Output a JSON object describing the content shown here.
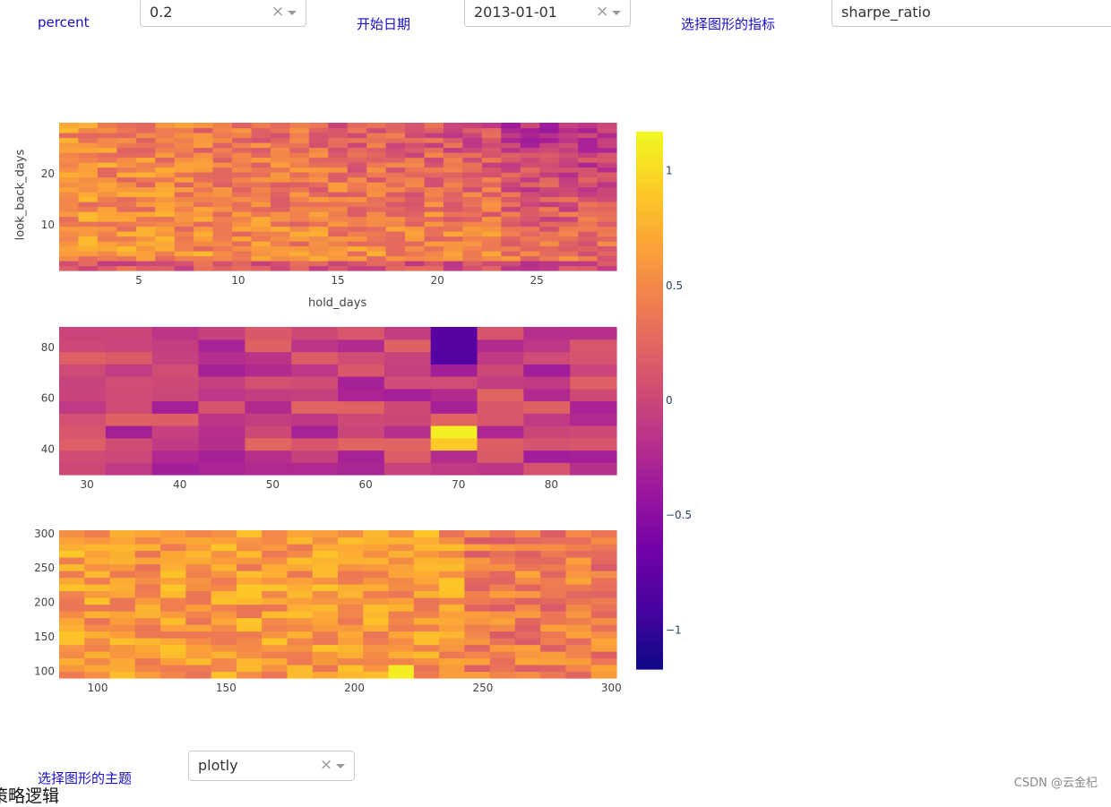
{
  "controls": {
    "percent_label": "percent",
    "percent_value": "0.2",
    "start_date_label": "开始日期",
    "start_date_value": "2013-01-01",
    "metric_label": "选择图形的指标",
    "metric_value": "sharpe_ratio",
    "theme_label": "选择图形的主题",
    "theme_value": "plotly",
    "clear_icon": "×"
  },
  "chart_data": [
    {
      "type": "heatmap",
      "xlabel": "hold_days",
      "ylabel": "look_back_days",
      "x_range": [
        1,
        29
      ],
      "y_range": [
        1,
        30
      ],
      "x_ticks": [
        5,
        10,
        15,
        20,
        25
      ],
      "y_ticks": [
        10,
        20
      ],
      "z_range": [
        -1.2,
        1.2
      ],
      "note": "values approx, gradient near 0.3-0.8 with noise"
    },
    {
      "type": "heatmap",
      "xlabel": "",
      "ylabel": "",
      "x_range": [
        27,
        87
      ],
      "y_range": [
        30,
        88
      ],
      "x_ticks": [
        30,
        40,
        50,
        60,
        70,
        80
      ],
      "y_ticks": [
        40,
        60,
        80
      ],
      "z_range": [
        -1.2,
        1.2
      ]
    },
    {
      "type": "heatmap",
      "xlabel": "",
      "ylabel": "",
      "x_range": [
        85,
        302
      ],
      "y_range": [
        90,
        305
      ],
      "x_ticks": [
        100,
        150,
        200,
        250,
        300
      ],
      "y_ticks": [
        100,
        150,
        200,
        250,
        300
      ],
      "z_range": [
        -1.2,
        1.2
      ]
    }
  ],
  "colorbar": {
    "ticks": [
      "1",
      "0.5",
      "0",
      "−0.5",
      "−1"
    ],
    "tick_values": [
      1,
      0.5,
      0,
      -0.5,
      -1
    ],
    "range": [
      -1.17,
      1.17
    ],
    "colorscale": [
      "#0d0887",
      "#46039f",
      "#7201a8",
      "#9c179e",
      "#bd3786",
      "#d8576b",
      "#ed7953",
      "#fb9f3a",
      "#fdca26",
      "#f0f921"
    ]
  },
  "footer": {
    "cut_text": "策略逻辑",
    "watermark": "CSDN @云金杞"
  }
}
